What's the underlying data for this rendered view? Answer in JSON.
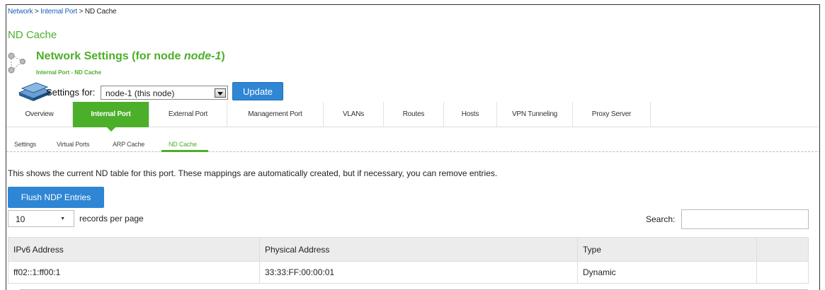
{
  "breadcrumb": {
    "items": [
      "Network",
      "Internal Port"
    ],
    "separator": ">",
    "current": "ND Cache"
  },
  "page_heading": "ND Cache",
  "network_settings": {
    "title_prefix": "Network Settings (for node ",
    "node_name": "node-1",
    "title_suffix": ")",
    "subtitle": "Internal Port - ND Cache"
  },
  "settings_for": {
    "label": "Settings for:",
    "selected": "node-1 (this node)",
    "update_label": "Update"
  },
  "tabs": [
    {
      "label": "Overview",
      "active": false
    },
    {
      "label": "Internal Port",
      "active": true
    },
    {
      "label": "External Port",
      "active": false
    },
    {
      "label": "Management Port",
      "active": false
    },
    {
      "label": "VLANs",
      "active": false
    },
    {
      "label": "Routes",
      "active": false
    },
    {
      "label": "Hosts",
      "active": false
    },
    {
      "label": "VPN Tunneling",
      "active": false
    },
    {
      "label": "Proxy Server",
      "active": false
    }
  ],
  "subtabs": [
    {
      "label": "Settings",
      "active": false
    },
    {
      "label": "Virtual Ports",
      "active": false
    },
    {
      "label": "ARP Cache",
      "active": false
    },
    {
      "label": "ND Cache",
      "active": true
    }
  ],
  "description": "This shows the current ND table for this port. These mappings are automatically created, but if necessary, you can remove entries.",
  "flush_label": "Flush NDP Entries",
  "records": {
    "selected": "10",
    "label": "records per page"
  },
  "search": {
    "label": "Search:",
    "value": ""
  },
  "table": {
    "headers": [
      "IPv6 Address",
      "Physical Address",
      "Type"
    ],
    "rows": [
      [
        "ff02::1:ff00:1",
        "33:33:FF:00:00:01",
        "Dynamic"
      ]
    ]
  },
  "colors": {
    "accent_green": "#4caf2a",
    "button_blue": "#2e86d4",
    "link_blue": "#1a5fb4"
  }
}
